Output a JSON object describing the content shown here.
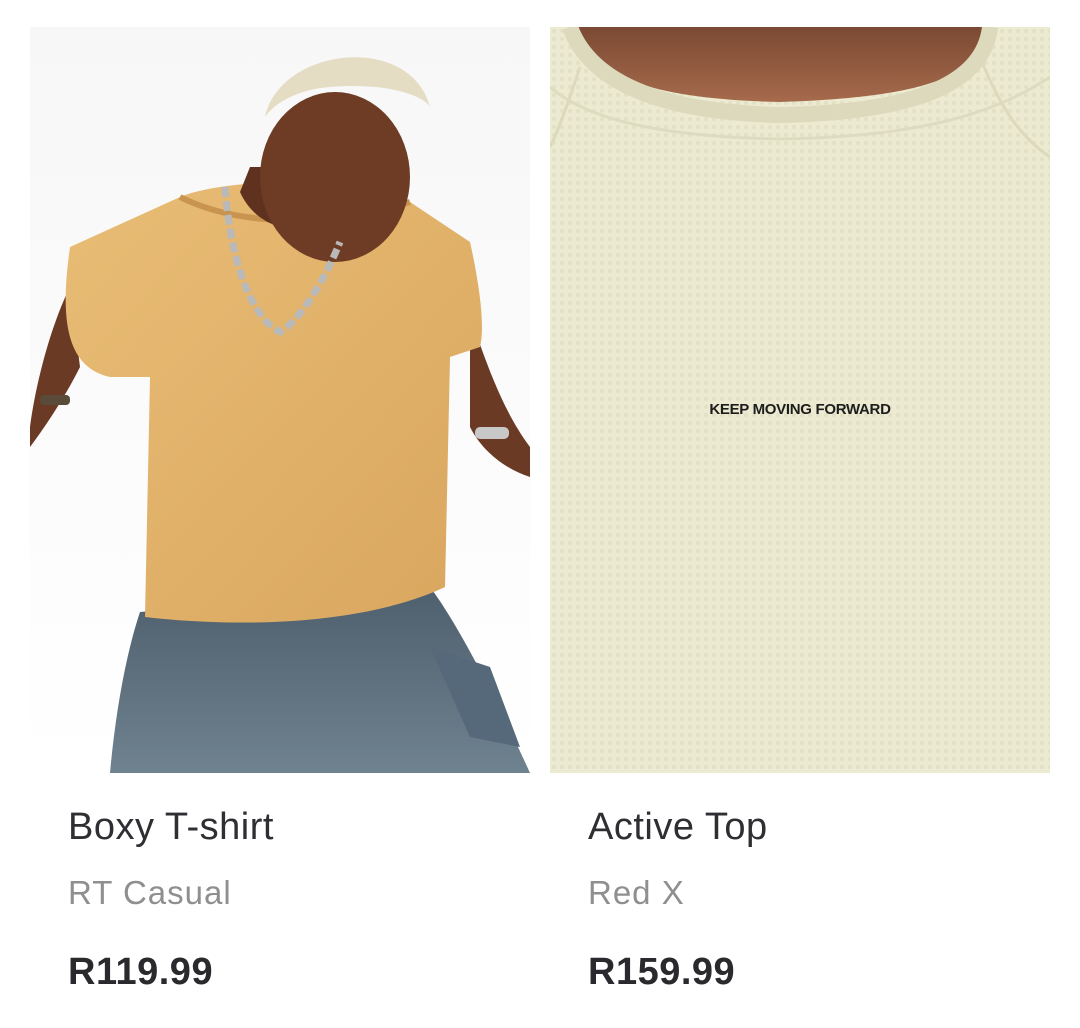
{
  "products": [
    {
      "title": "Boxy T-shirt",
      "brand": "RT Casual",
      "price": "R119.99",
      "image_desc": "model in mustard acid-wash t-shirt and jeans"
    },
    {
      "title": "Active Top",
      "brand": "Red X",
      "price": "R159.99",
      "print_text": "KEEP MOVING FORWARD"
    }
  ],
  "colors": {
    "title": "#2e2e33",
    "brand": "#8f8f8f",
    "price": "#2a2a2e",
    "tee_mustard": "#e2b46d",
    "tee_cream": "#ecead0"
  }
}
